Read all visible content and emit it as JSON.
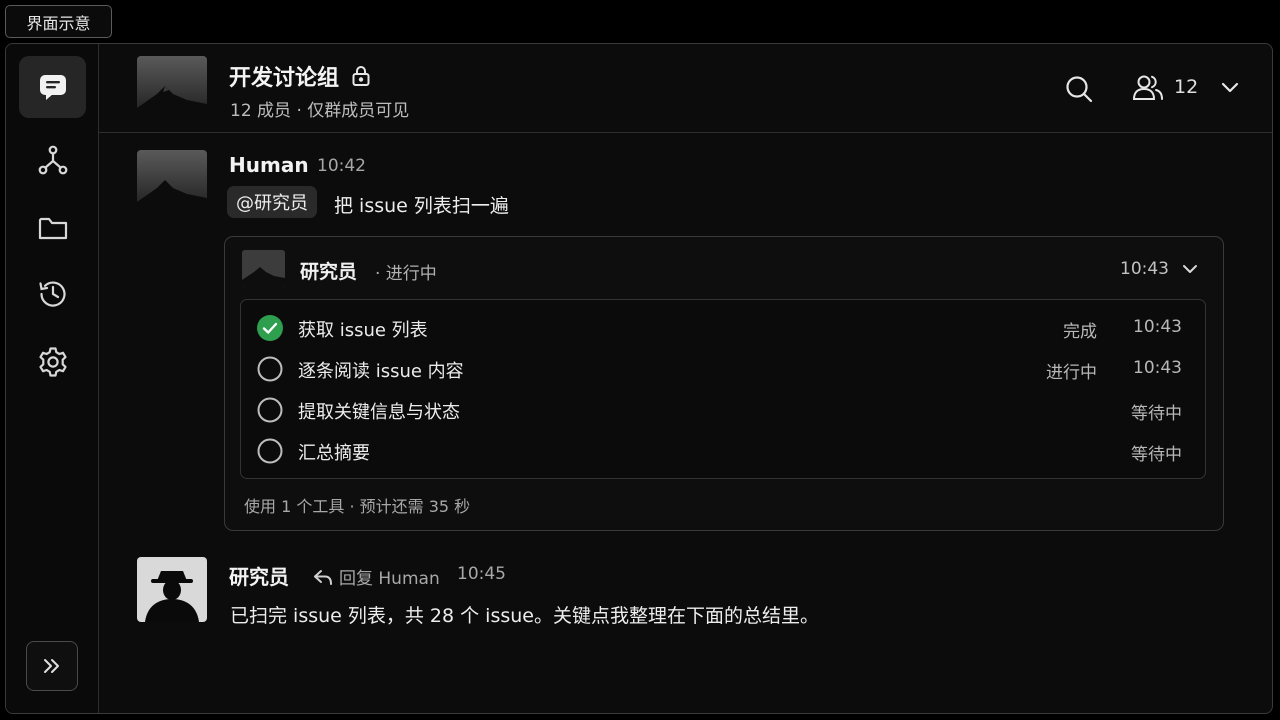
{
  "top_label": "界面示意",
  "header": {
    "title": "开发讨论组",
    "subtitle": "12 成员 · 仅群成员可见",
    "member_count": "12"
  },
  "messages": [
    {
      "author": "Human",
      "time": "10:42",
      "mention": "@研究员",
      "text": "把 issue 列表扫一遍"
    },
    {
      "author": "研究员",
      "reply_label": "回复 Human",
      "time": "10:45",
      "text": "已扫完 issue 列表，共 28 个 issue。关键点我整理在下面的总结里。"
    }
  ],
  "task": {
    "agent": "研究员",
    "status": "· 进行中",
    "time": "10:43",
    "steps": [
      {
        "label": "获取 issue 列表",
        "state": "完成",
        "time": "10:43",
        "done": true
      },
      {
        "label": "逐条阅读 issue 内容",
        "state": "进行中",
        "time": "10:43",
        "done": false
      },
      {
        "label": "提取关键信息与状态",
        "state": "等待中",
        "time": "",
        "done": false
      },
      {
        "label": "汇总摘要",
        "state": "等待中",
        "time": "",
        "done": false
      }
    ],
    "footer": "使用 1 个工具 · 预计还需 35 秒"
  },
  "colors": {
    "accent_done": "#2e9e4f",
    "background": "#0c0c0c"
  },
  "icons": {
    "sidebar": [
      "chat-icon",
      "agents-icon",
      "folder-icon",
      "history-icon",
      "settings-icon"
    ],
    "header": [
      "lock-icon",
      "search-icon",
      "members-icon",
      "chevron-down-icon"
    ]
  }
}
